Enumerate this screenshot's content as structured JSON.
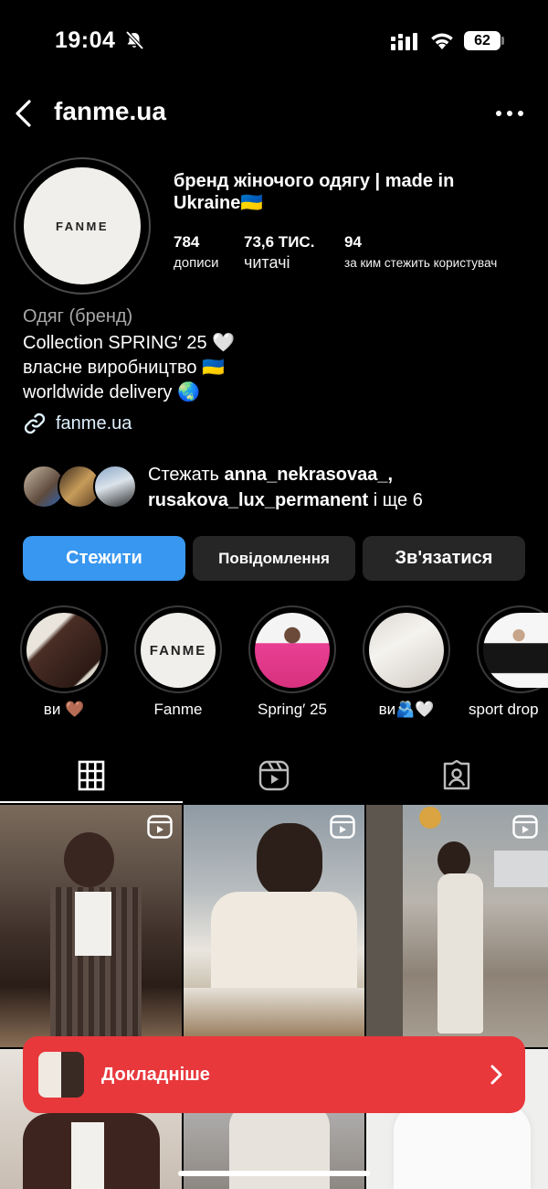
{
  "status": {
    "time": "19:04",
    "battery": "62"
  },
  "header": {
    "username": "fanme.ua"
  },
  "profile": {
    "avatar_text": "FANME",
    "name": "бренд жіночого одягу | made in Ukraine🇺🇦",
    "stats": [
      {
        "value": "784",
        "label": "дописи"
      },
      {
        "value": "73,6 ТИС.",
        "label": "читачі"
      },
      {
        "value": "94",
        "label": "за ким стежить користувач"
      }
    ],
    "category": "Одяг (бренд)",
    "bio": [
      "Collection SPRING′ 25 🤍",
      "власне виробництво 🇺🇦",
      "worldwide delivery 🌏"
    ],
    "link": "fanme.ua"
  },
  "followed_by": {
    "prefix": "Стежать ",
    "names": "anna_nekrasovaa_,",
    "line2_name": "rusakova_lux_permanent",
    "suffix": " і ще 6"
  },
  "buttons": {
    "follow": "Стежити",
    "message": "Повідомлення",
    "contact": "Зв'язатися"
  },
  "highlights": [
    {
      "label": "ви 🤎"
    },
    {
      "label": "Fanme",
      "inner_text": "FANME"
    },
    {
      "label": "Spring′ 25"
    },
    {
      "label": "ви🫂🤍"
    },
    {
      "label": "sport drop"
    }
  ],
  "tabs": [
    {
      "icon": "grid-icon"
    },
    {
      "icon": "reels-icon"
    },
    {
      "icon": "tagged-icon"
    }
  ],
  "banner": {
    "label": "Докладніше"
  },
  "colors": {
    "accent": "#3897f0",
    "banner": "#e8383c",
    "button_dark": "#262626"
  }
}
